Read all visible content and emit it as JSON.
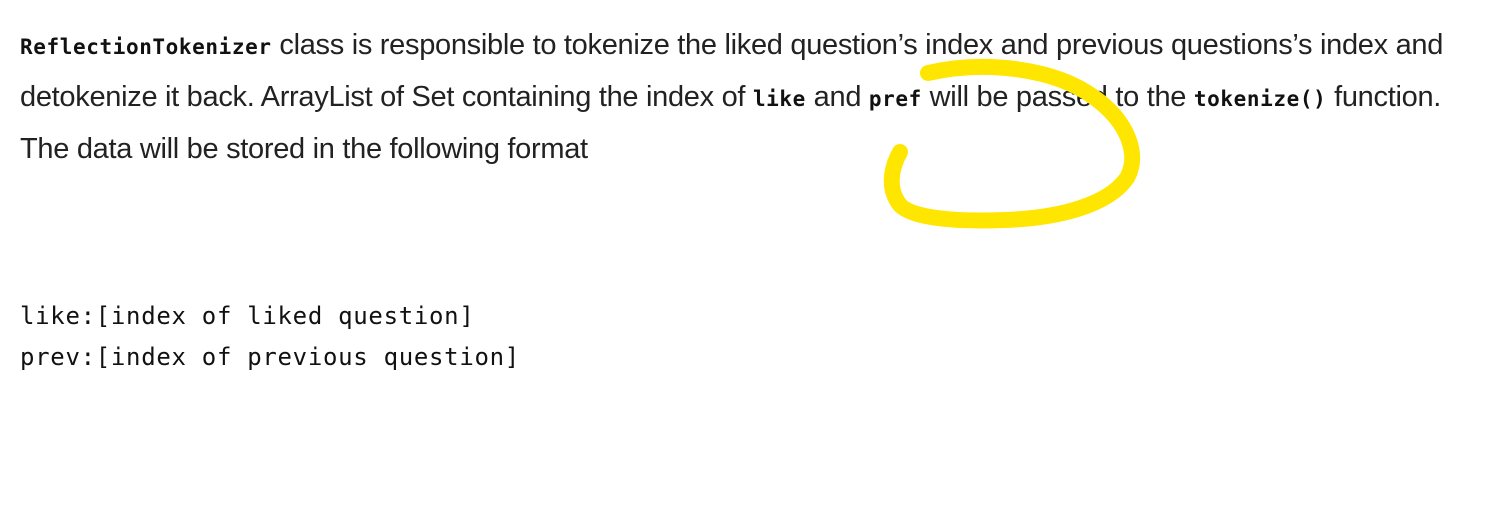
{
  "paragraph": {
    "class_name": "ReflectionTokenizer",
    "text_1": " class is responsible to tokenize the liked question’s index and previous questions’s index and detokenize it back. ArrayList of Set containing the index of ",
    "code_like": "like",
    "text_2": " and ",
    "code_pref": "pref",
    "text_3": " will be passed to the ",
    "code_tokenize": "tokenize()",
    "text_4": " function. The data will be stored in the following format"
  },
  "code_block": {
    "lines": [
      "like:[index of liked question]",
      "prev:[index of previous question]"
    ]
  },
  "annotation": {
    "color": "#FFE600"
  }
}
